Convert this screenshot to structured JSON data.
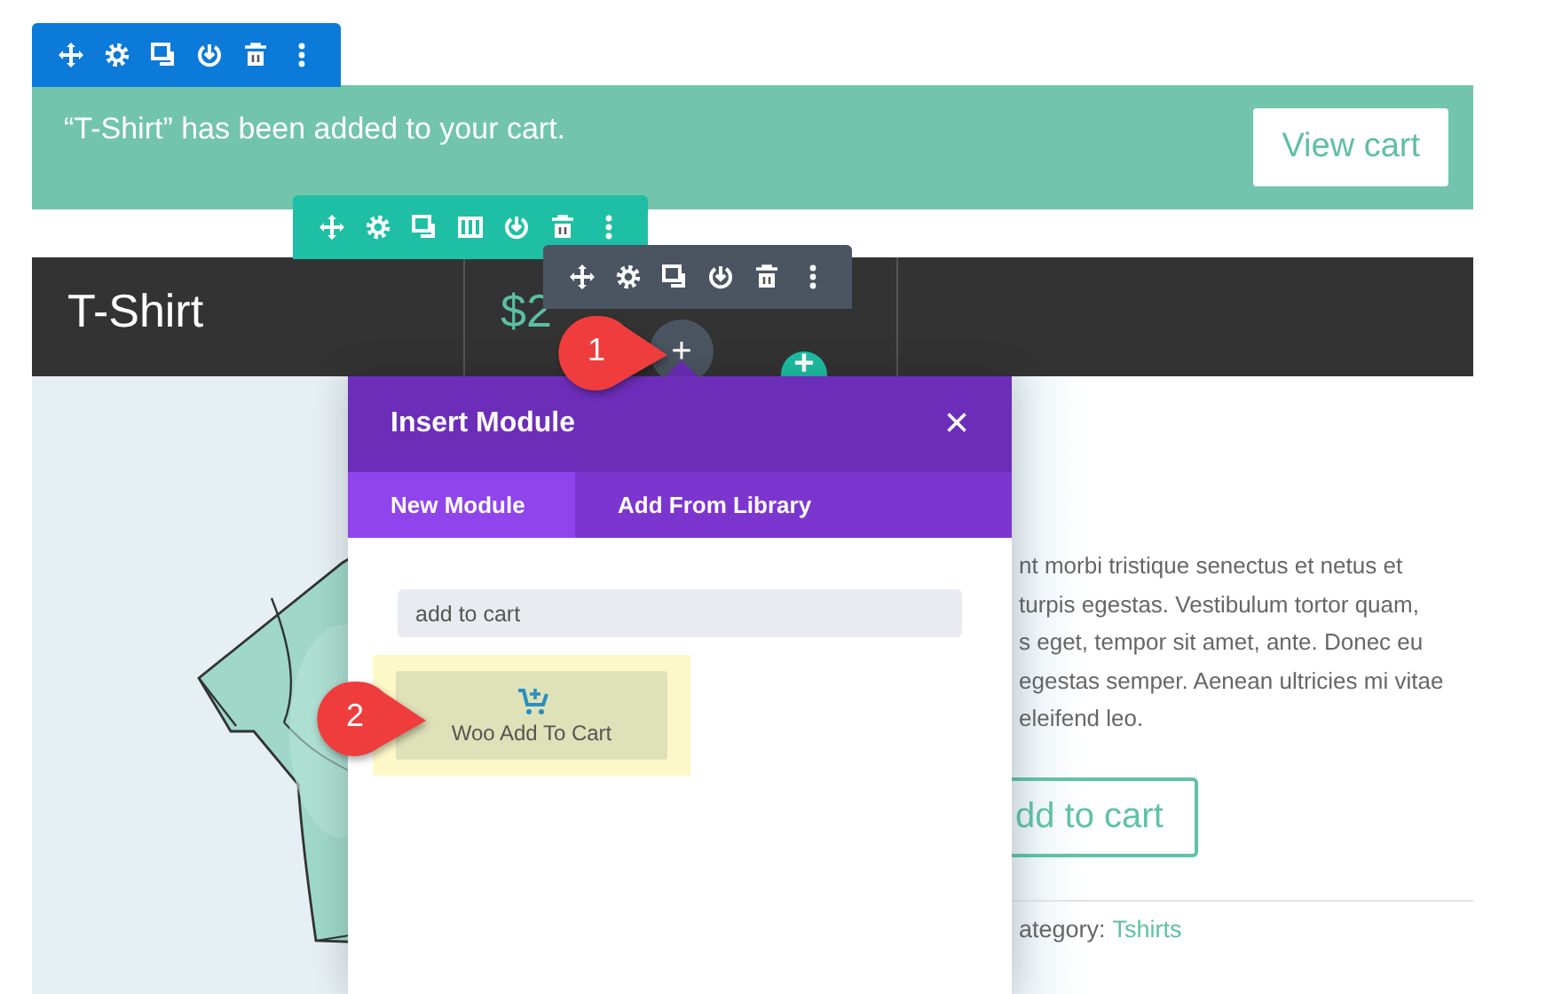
{
  "toolbars": [
    {
      "kind": "section"
    },
    {
      "kind": "row"
    },
    {
      "kind": "module"
    }
  ],
  "notice": {
    "message": "“T-Shirt” has been added to your cart.",
    "button": "View cart"
  },
  "product": {
    "title": "T-Shirt",
    "price": "$2",
    "description_lines": [
      "nt morbi tristique senectus et netus et",
      "turpis egestas. Vestibulum tortor quam,",
      "s eget, tempor sit amet, ante. Donec eu",
      "egestas semper. Aenean ultricies mi vitae",
      "eleifend leo."
    ],
    "add_button": "dd to cart",
    "category_label": "ategory:",
    "category_link": "Tshirts"
  },
  "add_module_button": {
    "label": "+"
  },
  "add_row_button": {
    "label": "+"
  },
  "modal": {
    "title": "Insert Module",
    "close": "×",
    "tabs": [
      {
        "label": "New Module",
        "selected": true
      },
      {
        "label": "Add From Library",
        "selected": false
      }
    ],
    "search": {
      "value": "add to cart"
    },
    "results": [
      {
        "label": "Woo Add To Cart",
        "highlighted": true
      }
    ]
  },
  "callouts": [
    {
      "number": "1"
    },
    {
      "number": "2"
    }
  ]
}
